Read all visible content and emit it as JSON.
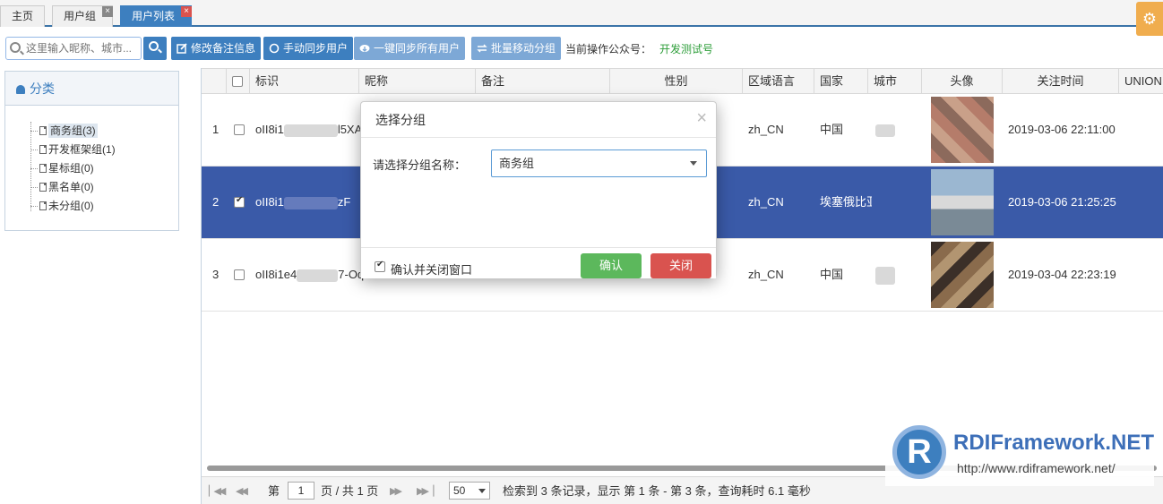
{
  "tabs": [
    {
      "label": "主页",
      "closable": false,
      "active": false
    },
    {
      "label": "用户组",
      "closable": true,
      "active": false
    },
    {
      "label": "用户列表",
      "closable": true,
      "active": true
    }
  ],
  "toolbar": {
    "search_placeholder": "这里输入昵称、城市...",
    "edit_remark": "修改备注信息",
    "manual_sync": "手动同步用户",
    "sync_all": "一键同步所有用户",
    "batch_move": "批量移动分组",
    "account_label": "当前操作公众号：",
    "account_value": "开发测试号"
  },
  "sidebar": {
    "title": "分类",
    "groups": [
      {
        "label": "商务组(3)",
        "selected": true
      },
      {
        "label": "开发框架组(1)",
        "selected": false
      },
      {
        "label": "星标组(0)",
        "selected": false
      },
      {
        "label": "黑名单(0)",
        "selected": false
      },
      {
        "label": "未分组(0)",
        "selected": false
      }
    ]
  },
  "grid": {
    "columns": [
      "标识",
      "昵称",
      "备注",
      "性别",
      "区域语言",
      "国家",
      "城市",
      "头像",
      "关注时间",
      "UNION"
    ],
    "rows": [
      {
        "num": "1",
        "checked": false,
        "id_prefix": "oII8i1",
        "id_suffix": "l5XA",
        "lang": "zh_CN",
        "country": "中国",
        "time": "2019-03-06 22:11:00"
      },
      {
        "num": "2",
        "checked": true,
        "id_prefix": "oII8i1",
        "id_suffix": "zF",
        "lang": "zh_CN",
        "country": "埃塞俄比亚",
        "time": "2019-03-06 21:25:25"
      },
      {
        "num": "3",
        "checked": false,
        "id_prefix": "oII8i1e4",
        "id_suffix": "7-Oq",
        "lang": "zh_CN",
        "country": "中国",
        "time": "2019-03-04 22:23:19"
      }
    ]
  },
  "pager": {
    "page_label": "第",
    "page_value": "1",
    "page_total": "页 / 共 1 页",
    "page_size": "50",
    "summary": "检索到 3 条记录，显示 第 1 条 - 第 3 条，查询耗时 6.1 毫秒"
  },
  "modal": {
    "title": "选择分组",
    "label": "请选择分组名称：",
    "selected_group": "商务组",
    "confirm_close_label": "确认并关闭窗口",
    "confirm_close_checked": true,
    "ok": "确认",
    "close": "关闭"
  },
  "watermark": {
    "logo_letter": "R",
    "title": "RDIFramework.NET",
    "url": "http://www.rdiframework.net/"
  }
}
